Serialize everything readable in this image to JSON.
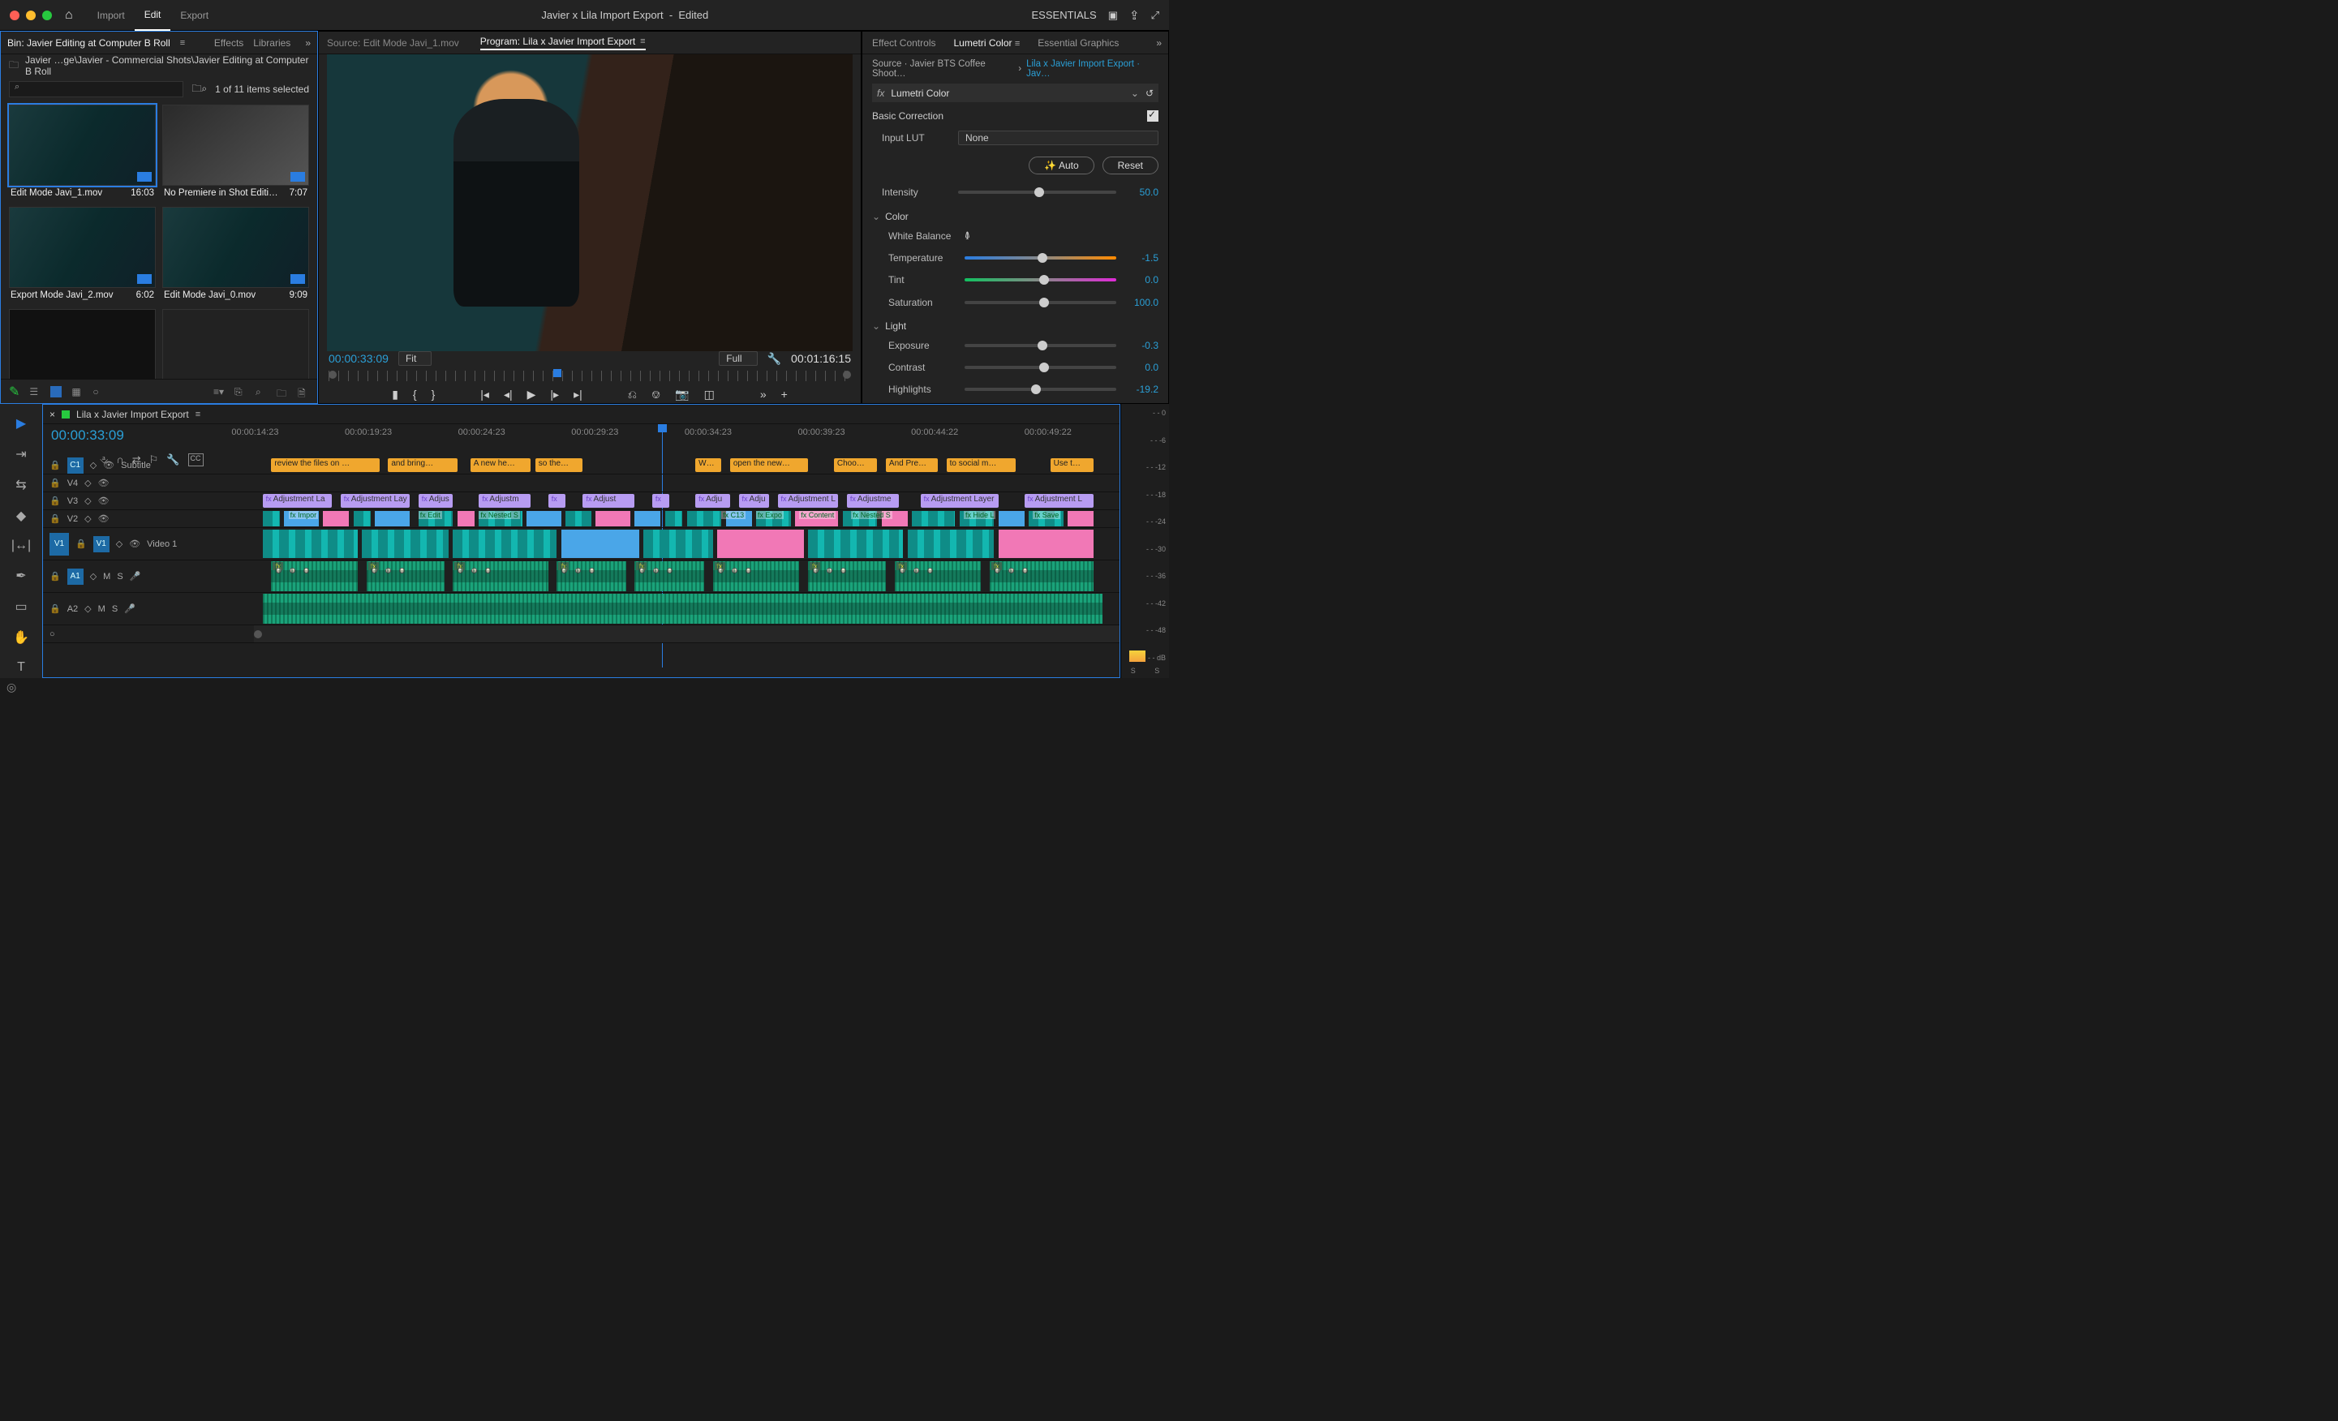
{
  "titlebar": {
    "tabs": [
      "Import",
      "Edit",
      "Export"
    ],
    "active_tab": "Edit",
    "project_title": "Javier x Lila Import Export",
    "project_status": "Edited",
    "workspace": "ESSENTIALS"
  },
  "project_panel": {
    "tabs": {
      "bin": "Bin: Javier Editing at Computer B Roll",
      "effects": "Effects",
      "libraries": "Libraries"
    },
    "breadcrumb": "Javier …ge\\Javier - Commercial Shots\\Javier Editing at Computer B Roll",
    "selection": "1 of 11 items selected",
    "clips": [
      {
        "name": "Edit Mode Javi_1.mov",
        "dur": "16:03",
        "selected": true
      },
      {
        "name": "No Premiere in Shot Editi…",
        "dur": "7:07",
        "selected": false
      },
      {
        "name": "Export Mode Javi_2.mov",
        "dur": "6:02",
        "selected": false
      },
      {
        "name": "Edit Mode Javi_0.mov",
        "dur": "9:09",
        "selected": false
      }
    ]
  },
  "monitor": {
    "source_tab": "Source: Edit Mode Javi_1.mov",
    "program_tab": "Program: Lila x Javier Import Export",
    "timecode": "00:00:33:09",
    "fit": "Fit",
    "zoom": "Full",
    "duration": "00:01:16:15"
  },
  "lumetri": {
    "tabs": [
      "Effect Controls",
      "Lumetri Color",
      "Essential Graphics"
    ],
    "source_clip": "Source · Javier BTS Coffee Shoot…",
    "sequence": "Lila x Javier Import Export · Jav…",
    "effect_name": "Lumetri Color",
    "section": "Basic Correction",
    "input_lut_label": "Input LUT",
    "input_lut": "None",
    "auto": "Auto",
    "reset": "Reset",
    "intensity_label": "Intensity",
    "intensity": "50.0",
    "color_heading": "Color",
    "wb_label": "White Balance",
    "temp_label": "Temperature",
    "temp": "-1.5",
    "tint_label": "Tint",
    "tint": "0.0",
    "sat_label": "Saturation",
    "sat": "100.0",
    "light_heading": "Light",
    "exp_label": "Exposure",
    "exp": "-0.3",
    "con_label": "Contrast",
    "con": "0.0",
    "hl_label": "Highlights",
    "hl": "-19.2"
  },
  "timeline": {
    "sequence_name": "Lila x Javier Import Export",
    "timecode": "00:00:33:09",
    "ruler": [
      "00:00:14:23",
      "00:00:19:23",
      "00:00:24:23",
      "00:00:29:23",
      "00:00:34:23",
      "00:00:39:23",
      "00:00:44:22",
      "00:00:49:22"
    ],
    "tracks": {
      "subtitle": {
        "target": "C1",
        "label": "Subtitle"
      },
      "v4": "V4",
      "v3": "V3",
      "v2": "V2",
      "v1": {
        "target": "V1",
        "src": "V1",
        "label": "Video 1"
      },
      "a1": {
        "target": "A1",
        "m": "M",
        "s": "S"
      },
      "a2": {
        "target": "A2",
        "m": "M",
        "s": "S"
      }
    },
    "captions": [
      {
        "l": 2,
        "w": 12.5,
        "t": "review the files on …"
      },
      {
        "l": 15.5,
        "w": 8,
        "t": "and bring…"
      },
      {
        "l": 25,
        "w": 7,
        "t": "A new he…"
      },
      {
        "l": 32.5,
        "w": 5.5,
        "t": "so the…"
      },
      {
        "l": 51,
        "w": 3,
        "t": "W…"
      },
      {
        "l": 55,
        "w": 9,
        "t": "open the new…"
      },
      {
        "l": 67,
        "w": 5,
        "t": "Choo…"
      },
      {
        "l": 73,
        "w": 6,
        "t": "And Pre…"
      },
      {
        "l": 80,
        "w": 8,
        "t": "to social m…"
      },
      {
        "l": 92,
        "w": 5,
        "t": "Use t…"
      }
    ],
    "adjust_v3": [
      {
        "l": 1,
        "w": 8,
        "t": "Adjustment La"
      },
      {
        "l": 10,
        "w": 8,
        "t": "Adjustment Lay"
      },
      {
        "l": 19,
        "w": 4,
        "t": "Adjus"
      },
      {
        "l": 26,
        "w": 6,
        "t": "Adjustm"
      },
      {
        "l": 34,
        "w": 2,
        "t": ""
      },
      {
        "l": 38,
        "w": 6,
        "t": "Adjust"
      },
      {
        "l": 46,
        "w": 2,
        "t": ""
      },
      {
        "l": 51,
        "w": 4,
        "t": "Adju"
      },
      {
        "l": 56,
        "w": 3.5,
        "t": "Adju"
      },
      {
        "l": 60.5,
        "w": 7,
        "t": "Adjustment L"
      },
      {
        "l": 68.5,
        "w": 6,
        "t": "Adjustme"
      },
      {
        "l": 77,
        "w": 9,
        "t": "Adjustment Layer"
      },
      {
        "l": 89,
        "w": 8,
        "t": "Adjustment L"
      }
    ],
    "v1_labels": [
      {
        "l": 4,
        "w": 4,
        "t": "Impor",
        "c": "blue"
      },
      {
        "l": 19,
        "w": 4,
        "t": "Edit",
        "c": ""
      },
      {
        "l": 26,
        "w": 5,
        "t": "Nested S",
        "c": ""
      },
      {
        "l": 54,
        "w": 3,
        "t": "C13",
        "c": ""
      },
      {
        "l": 58,
        "w": 4,
        "t": "Expo",
        "c": ""
      },
      {
        "l": 63,
        "w": 5,
        "t": "Content",
        "c": "pink"
      },
      {
        "l": 69,
        "w": 5,
        "t": "Nested S",
        "c": ""
      },
      {
        "l": 82,
        "w": 4,
        "t": "Hide L",
        "c": ""
      },
      {
        "l": 90,
        "w": 4,
        "t": "Save",
        "c": ""
      }
    ]
  },
  "meters": {
    "scale": [
      "0",
      "-6",
      "-12",
      "-18",
      "-24",
      "-30",
      "-36",
      "-42",
      "-48",
      "dB"
    ],
    "solo": "S"
  }
}
